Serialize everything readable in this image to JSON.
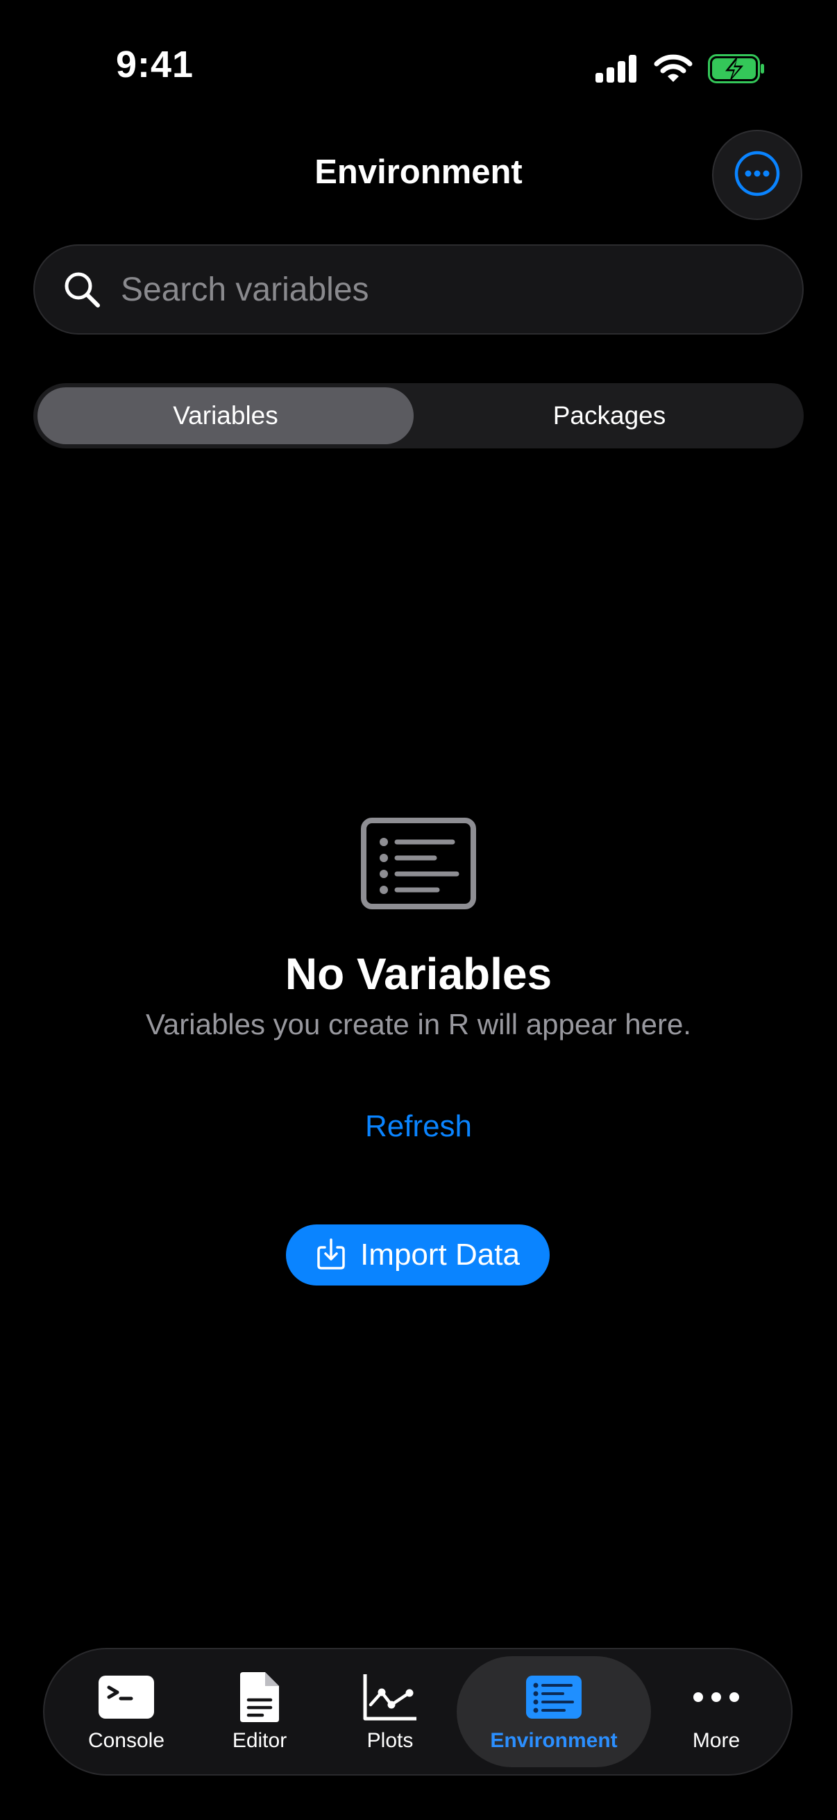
{
  "status_bar": {
    "time": "9:41",
    "icons": [
      "cellular-signal-icon",
      "wifi-icon",
      "battery-charging-icon"
    ]
  },
  "header": {
    "title": "Environment",
    "more_icon": "ellipsis-circle-icon"
  },
  "search": {
    "placeholder": "Search variables",
    "value": "",
    "icon": "magnifying-glass-icon"
  },
  "segments": {
    "items": [
      {
        "label": "Variables",
        "selected": true
      },
      {
        "label": "Packages",
        "selected": false
      }
    ]
  },
  "empty_state": {
    "icon": "list-bullet-rectangle-icon",
    "title": "No Variables",
    "subtitle": "Variables you create in R will appear here.",
    "refresh_label": "Refresh",
    "import_label": "Import Data",
    "import_icon": "download-arrow-icon"
  },
  "tab_bar": {
    "tabs": [
      {
        "label": "Console",
        "icon": "terminal-icon",
        "selected": false
      },
      {
        "label": "Editor",
        "icon": "document-icon",
        "selected": false
      },
      {
        "label": "Plots",
        "icon": "line-chart-icon",
        "selected": false
      },
      {
        "label": "Environment",
        "icon": "list-icon",
        "selected": true
      },
      {
        "label": "More",
        "icon": "ellipsis-icon",
        "selected": false
      }
    ]
  },
  "colors": {
    "background": "#000000",
    "accent": "#0a84ff",
    "secondary_text": "#98989e",
    "battery_fill": "#34c759"
  }
}
